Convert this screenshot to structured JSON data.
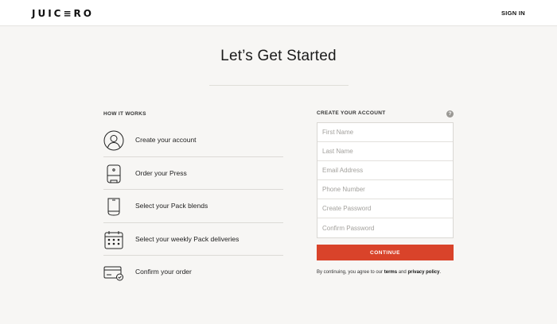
{
  "header": {
    "logo_text": "JUIC≡RO",
    "signin_label": "SIGN IN"
  },
  "page": {
    "title": "Let’s Get Started"
  },
  "how_it_works": {
    "label": "HOW IT WORKS",
    "steps": [
      {
        "icon": "user-icon",
        "label": "Create your account"
      },
      {
        "icon": "press-icon",
        "label": "Order your Press"
      },
      {
        "icon": "pack-icon",
        "label": "Select your Pack blends"
      },
      {
        "icon": "calendar-icon",
        "label": "Select your weekly Pack deliveries"
      },
      {
        "icon": "card-check-icon",
        "label": "Confirm your order"
      }
    ]
  },
  "account": {
    "label": "CREATE YOUR ACCOUNT",
    "help_glyph": "?",
    "fields": {
      "first_name": {
        "value": "",
        "placeholder": "First Name"
      },
      "last_name": {
        "value": "",
        "placeholder": "Last Name"
      },
      "email": {
        "value": "",
        "placeholder": "Email Address"
      },
      "phone": {
        "value": "",
        "placeholder": "Phone Number"
      },
      "password": {
        "value": "",
        "placeholder": "Create Password"
      },
      "confirm_password": {
        "value": "",
        "placeholder": "Confirm Password"
      }
    },
    "continue_label": "CONTINUE"
  },
  "terms": {
    "prefix": "By continuing, you agree to our ",
    "terms_link": "terms",
    "and": " and ",
    "privacy_link": "privacy policy",
    "suffix": "."
  },
  "colors": {
    "accent": "#d9432a",
    "background": "#f7f6f4"
  }
}
